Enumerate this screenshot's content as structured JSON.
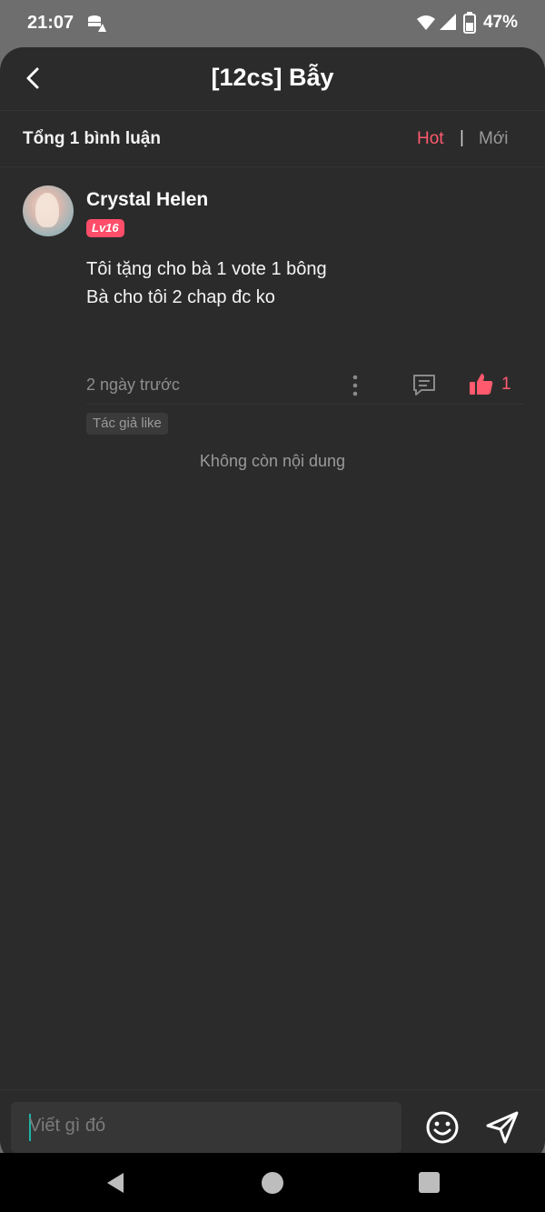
{
  "status_bar": {
    "time": "21:07",
    "battery_percent": "47%",
    "icons": [
      "data-saver-icon",
      "wifi-icon",
      "signal-icon",
      "battery-icon"
    ]
  },
  "header": {
    "title": "[12cs] Bẫy",
    "back_icon": "chevron-left-icon"
  },
  "comments_bar": {
    "total_label": "Tổng 1 bình luận",
    "sort_hot": "Hot",
    "separator": "|",
    "sort_new": "Mới",
    "active_color": "#ff5a6e"
  },
  "comments": [
    {
      "user_name": "Crystal Helen",
      "level": "Lv16",
      "text_line1": "Tôi tặng cho bà 1 vote 1 bông",
      "text_line2": "Bà cho tôi 2 chap đc ko",
      "time_ago": "2 ngày trước",
      "like_count": "1",
      "author_tag": "Tác giả like"
    }
  ],
  "end_note": "Không còn nội dung",
  "composer": {
    "placeholder": "Viết gì đó"
  },
  "colors": {
    "background": "#2b2b2b",
    "accent": "#ff5a6e",
    "level_badge": "#ff4d6a"
  }
}
